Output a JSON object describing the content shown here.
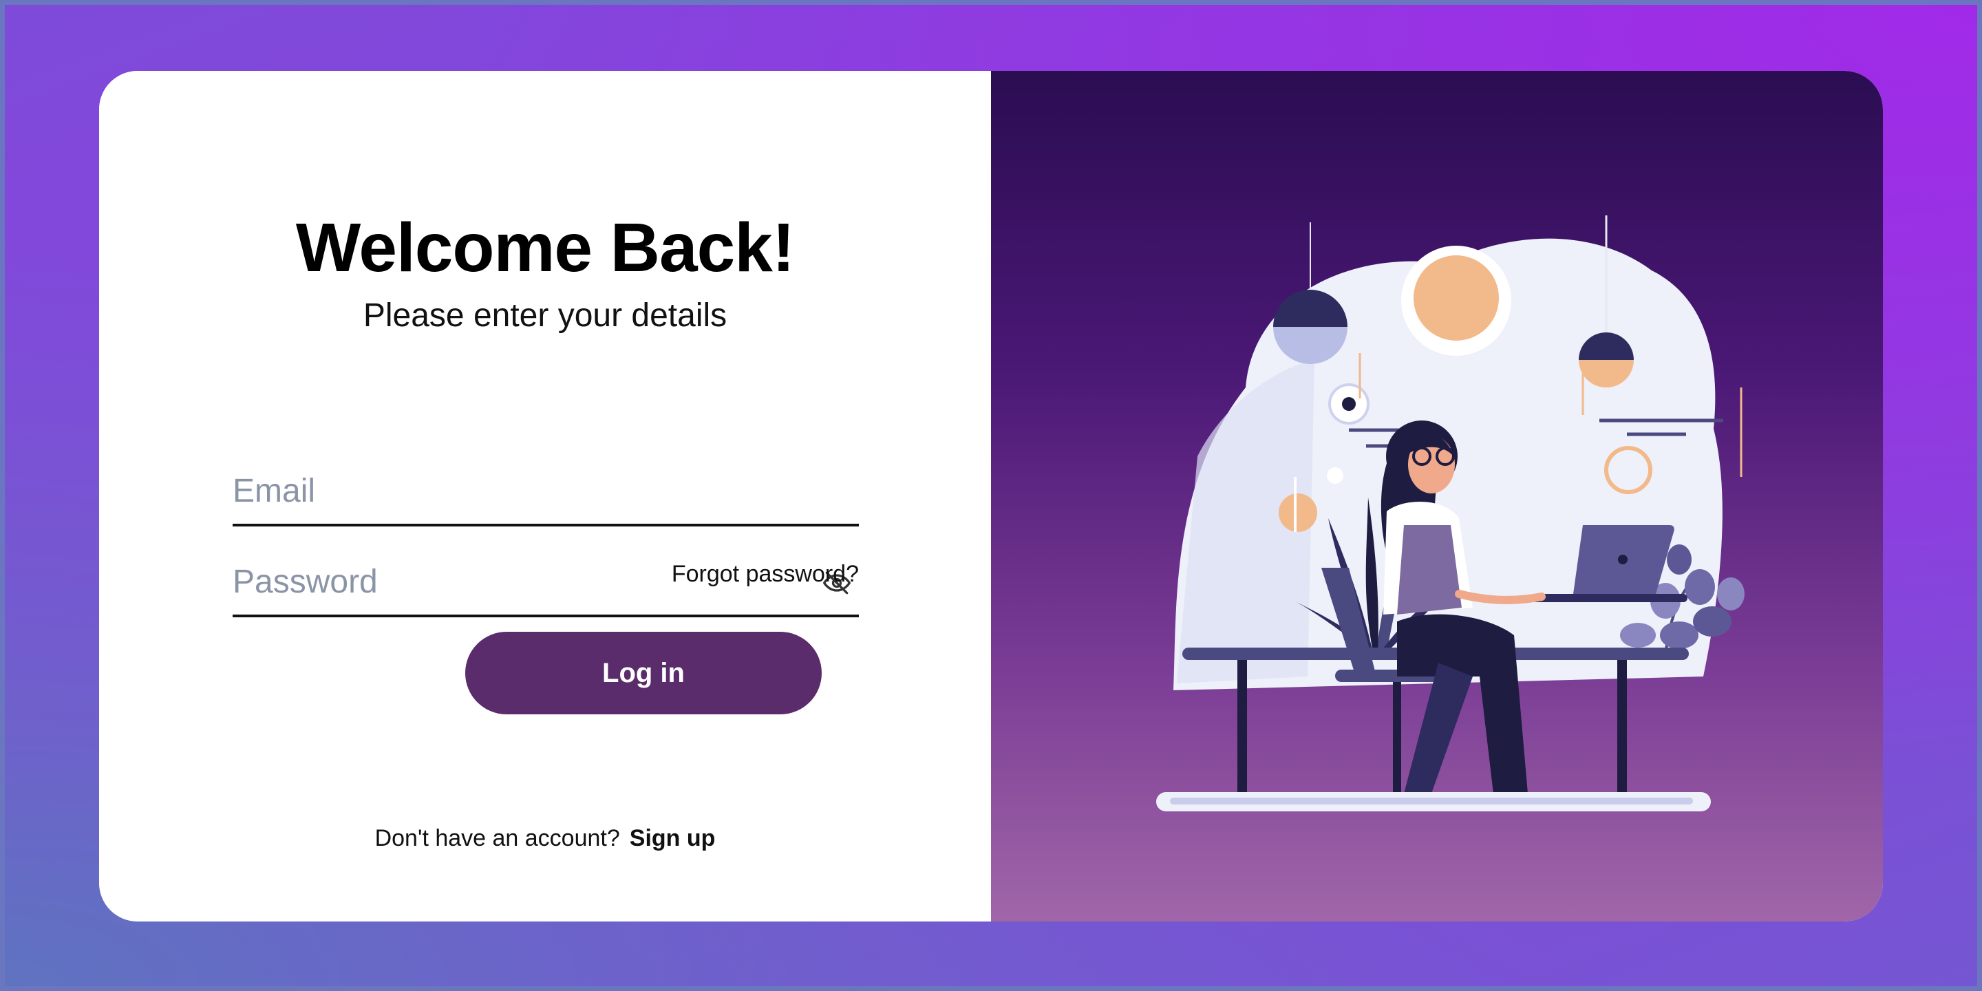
{
  "login": {
    "title": "Welcome Back!",
    "subtitle": "Please enter your details",
    "email_placeholder": "Email",
    "password_placeholder": "Password",
    "forgot_label": "Forgot password?",
    "login_label": "Log in",
    "signup_prompt": "Don't have an account?",
    "signup_label": "Sign up"
  },
  "icons": {
    "password_toggle": "eye-off-icon"
  },
  "colors": {
    "button": "#5b2c6b",
    "panel_top": "#2b0d52",
    "panel_bottom": "#a066a8",
    "background": "#8a3fe0"
  }
}
